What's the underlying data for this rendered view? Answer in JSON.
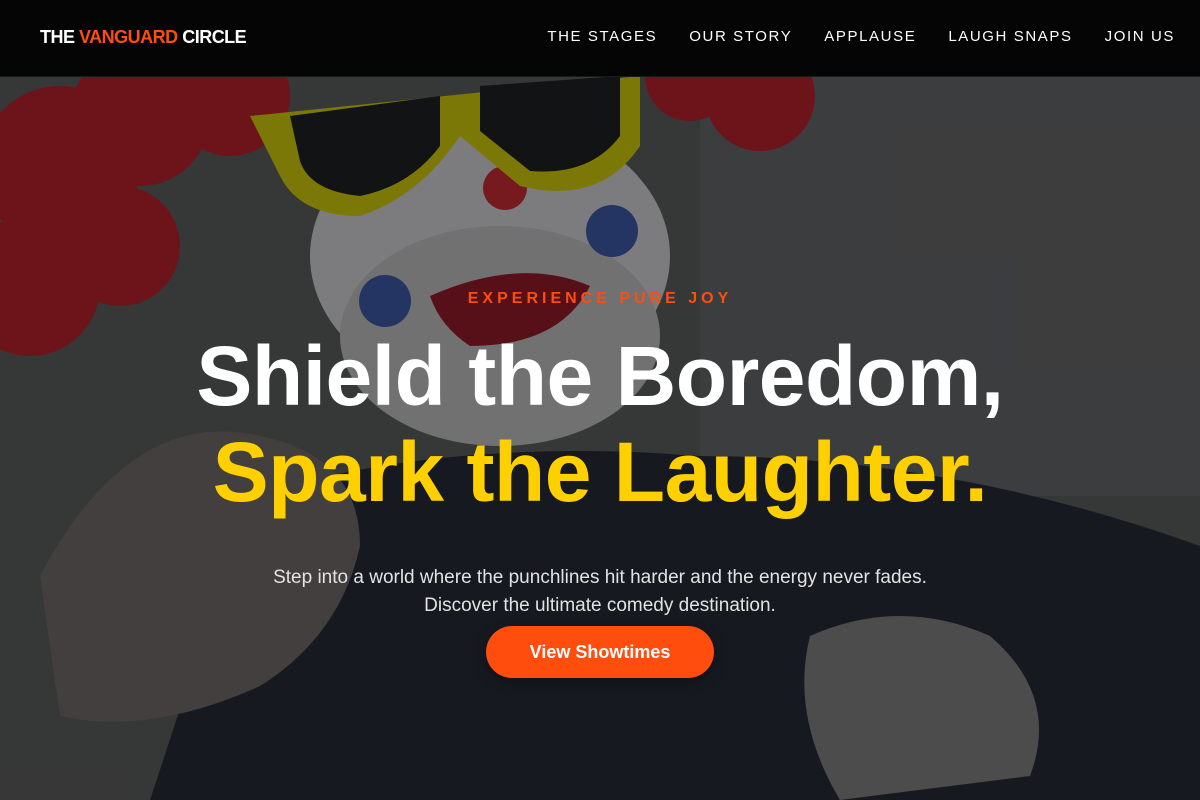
{
  "brand": {
    "prefix": "THE ",
    "accent": "VANGUARD",
    "suffix": " CIRCLE",
    "accent_color": "#ff4d0d"
  },
  "nav": {
    "items": [
      {
        "label": "THE STAGES"
      },
      {
        "label": "OUR STORY"
      },
      {
        "label": "APPLAUSE"
      },
      {
        "label": "LAUGH SNAPS"
      },
      {
        "label": "JOIN US"
      }
    ]
  },
  "hero": {
    "eyebrow": "EXPERIENCE PURE JOY",
    "headline_line1": "Shield the Boredom,",
    "headline_line2": "Spark the Laughter.",
    "subtext": "Step into a world where the punchlines hit harder and the energy never fades. Discover the ultimate comedy destination.",
    "cta_label": "View Showtimes",
    "colors": {
      "eyebrow": "#ff4d0d",
      "headline_primary": "#ffffff",
      "headline_highlight": "#ffd000",
      "cta_background": "#ff4d0d"
    },
    "background_image": "clown-photo"
  }
}
